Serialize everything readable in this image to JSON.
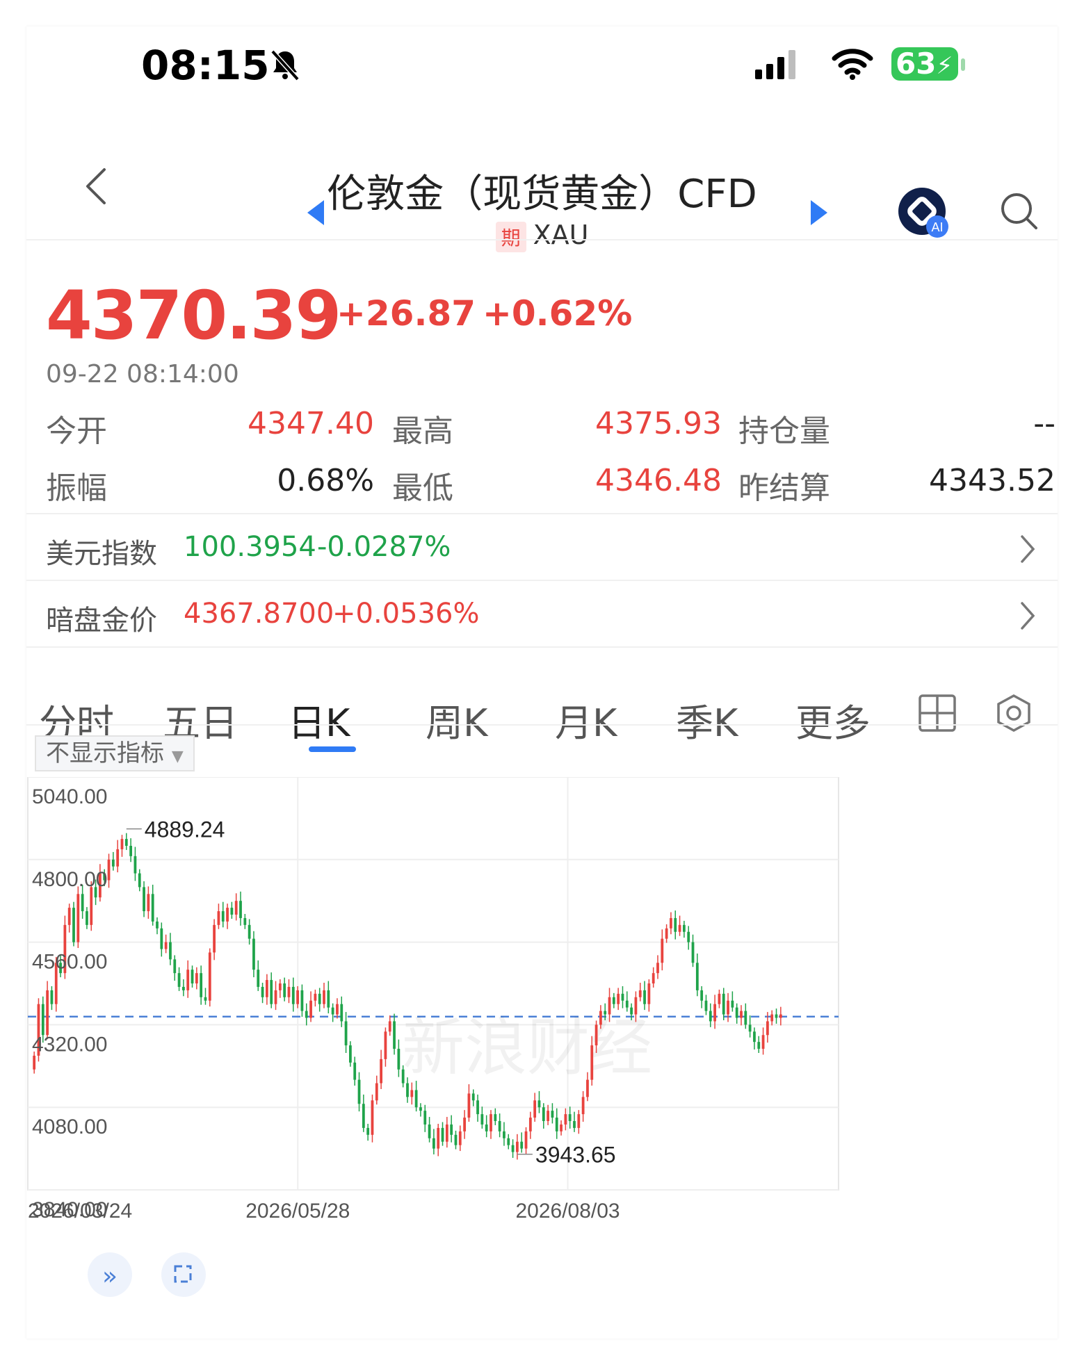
{
  "status_bar": {
    "time": "08:15",
    "battery": "63"
  },
  "header": {
    "title": "伦敦金（现货黄金）CFD",
    "tag": "期",
    "symbol": "XAU"
  },
  "quote": {
    "price": "4370.39",
    "change": "+26.87",
    "change_pct": "+0.62%",
    "timestamp": "09-22 08:14:00"
  },
  "stats": [
    {
      "label": "今开",
      "value": "4347.40",
      "color": "red"
    },
    {
      "label": "最高",
      "value": "4375.93",
      "color": "red"
    },
    {
      "label": "持仓量",
      "value": "--",
      "color": "dark"
    },
    {
      "label": "振幅",
      "value": "0.68%",
      "color": "dark"
    },
    {
      "label": "最低",
      "value": "4346.48",
      "color": "red"
    },
    {
      "label": "昨结算",
      "value": "4343.52",
      "color": "dark"
    }
  ],
  "index_rows": [
    {
      "label": "美元指数",
      "value": "100.3954",
      "change": "-0.0287%",
      "color": "green"
    },
    {
      "label": "暗盘金价",
      "value": "4367.8700",
      "change": "+0.0536%",
      "color": "red"
    }
  ],
  "tabs": [
    "分时",
    "五日",
    "日K",
    "周K",
    "月K",
    "季K",
    "更多"
  ],
  "active_tab": "日K",
  "indicator_select": "不显示指标",
  "watermark": "新浪财经",
  "chart_data": {
    "type": "candlestick",
    "y_ticks": [
      "5040.00",
      "4800.00",
      "4560.00",
      "4320.00",
      "4080.00",
      "3840.00"
    ],
    "ylim": [
      3840,
      5040
    ],
    "x_ticks": [
      "2026/03/24",
      "2026/05/28",
      "2026/08/03"
    ],
    "high_label": "4889.24",
    "low_label": "3943.65",
    "reference_line": 4343.52,
    "colors": {
      "up": "#e8433e",
      "down": "#1fa34a",
      "ref": "#4a7fd6"
    },
    "closes": [
      4230,
      4380,
      4290,
      4420,
      4380,
      4500,
      4470,
      4610,
      4660,
      4560,
      4700,
      4650,
      4610,
      4720,
      4690,
      4760,
      4740,
      4800,
      4780,
      4830,
      4860,
      4840,
      4810,
      4760,
      4720,
      4650,
      4700,
      4620,
      4600,
      4540,
      4560,
      4510,
      4470,
      4430,
      4420,
      4480,
      4440,
      4470,
      4400,
      4390,
      4530,
      4610,
      4650,
      4620,
      4660,
      4640,
      4680,
      4630,
      4610,
      4570,
      4480,
      4430,
      4400,
      4450,
      4380,
      4420,
      4440,
      4400,
      4430,
      4380,
      4420,
      4360,
      4340,
      4390,
      4410,
      4380,
      4420,
      4370,
      4350,
      4380,
      4330,
      4260,
      4210,
      4160,
      4090,
      4020,
      4000,
      4100,
      4150,
      4220,
      4300,
      4330,
      4250,
      4190,
      4150,
      4110,
      4130,
      4080,
      4070,
      4030,
      3990,
      3960,
      4020,
      3980,
      4030,
      4000,
      3970,
      4010,
      4050,
      4120,
      4100,
      4060,
      4030,
      4010,
      4060,
      4040,
      4010,
      3990,
      3970,
      3950,
      3980,
      3960,
      4010,
      4050,
      4100,
      4080,
      4040,
      4070,
      4050,
      4010,
      4030,
      4060,
      4040,
      4020,
      4060,
      4110,
      4160,
      4260,
      4320,
      4360,
      4350,
      4400,
      4380,
      4410,
      4390,
      4370,
      4350,
      4400,
      4420,
      4380,
      4440,
      4470,
      4500,
      4570,
      4600,
      4630,
      4590,
      4610,
      4590,
      4560,
      4500,
      4420,
      4390,
      4360,
      4330,
      4380,
      4410,
      4350,
      4390,
      4370,
      4340,
      4360,
      4320,
      4300,
      4270,
      4250,
      4290,
      4330,
      4350,
      4340,
      4350
    ]
  }
}
